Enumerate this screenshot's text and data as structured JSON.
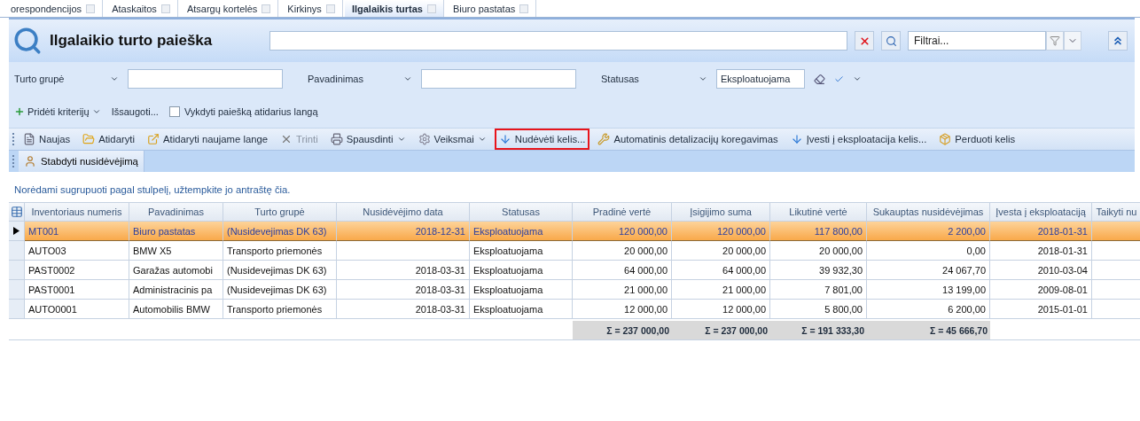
{
  "doc_tabs": [
    {
      "label": "orespondencijos",
      "selected": false
    },
    {
      "label": "Ataskaitos",
      "selected": false
    },
    {
      "label": "Atsargų kortelės",
      "selected": false
    },
    {
      "label": "Kirkinys",
      "selected": false
    },
    {
      "label": "Ilgalaikis turtas",
      "selected": true
    },
    {
      "label": "Biuro pastatas",
      "selected": false
    }
  ],
  "header": {
    "title": "Ilgalaikio turto paieška",
    "filter_placeholder": "Filtrai..."
  },
  "criteria": [
    {
      "label": "Turto grupė"
    },
    {
      "label": "Pavadinimas"
    },
    {
      "label": "Statusas",
      "value": "Eksploatuojama"
    }
  ],
  "criteria_actions": {
    "add": "Pridėti kriterijų",
    "save": "Išsaugoti...",
    "run_on_open": {
      "label": "Vykdyti paiešką atidarius langą",
      "checked": false
    }
  },
  "toolbar": [
    {
      "label": "Naujas",
      "disabled": false,
      "dropdown": false,
      "highlighted": false
    },
    {
      "label": "Atidaryti",
      "disabled": false,
      "dropdown": false,
      "highlighted": false
    },
    {
      "label": "Atidaryti naujame lange",
      "disabled": false,
      "dropdown": false,
      "highlighted": false
    },
    {
      "label": "Trinti",
      "disabled": true,
      "dropdown": false,
      "highlighted": false
    },
    {
      "label": "Spausdinti",
      "disabled": false,
      "dropdown": true,
      "highlighted": false
    },
    {
      "label": "Veiksmai",
      "disabled": false,
      "dropdown": true,
      "highlighted": false
    },
    {
      "label": "Nudėvėti kelis...",
      "disabled": false,
      "dropdown": false,
      "highlighted": true
    },
    {
      "label": "Automatinis detalizacijų koregavimas",
      "disabled": false,
      "dropdown": false,
      "highlighted": false
    },
    {
      "label": "Įvesti į eksploatacija kelis...",
      "disabled": false,
      "dropdown": false,
      "highlighted": false
    },
    {
      "label": "Perduoti kelis",
      "disabled": false,
      "dropdown": false,
      "highlighted": false
    }
  ],
  "toolbar2": [
    {
      "label": "Stabdyti nusidėvėjimą"
    }
  ],
  "group_hint": "Norėdami sugrupuoti pagal stulpelį, užtempkite jo antraštę čia.",
  "table": {
    "columns": [
      {
        "label": "Inventoriaus numeris",
        "kind": "text"
      },
      {
        "label": "Pavadinimas",
        "kind": "text"
      },
      {
        "label": "Turto grupė",
        "kind": "text"
      },
      {
        "label": "Nusidėvėjimo data",
        "kind": "number"
      },
      {
        "label": "Statusas",
        "kind": "text"
      },
      {
        "label": "Pradinė vertė",
        "kind": "number",
        "total": "Σ = 237 000,00"
      },
      {
        "label": "Įsigijimo suma",
        "kind": "number",
        "total": "Σ = 237 000,00"
      },
      {
        "label": "Likutinė vertė",
        "kind": "number",
        "total": "Σ = 191 333,30"
      },
      {
        "label": "Sukauptas nusidėvėjimas",
        "kind": "number",
        "total": "Σ = 45 666,70"
      },
      {
        "label": "Įvesta į eksploataciją",
        "kind": "number"
      },
      {
        "label": "Taikyti nu",
        "kind": "text"
      }
    ],
    "rows": [
      {
        "selected": true,
        "cells": [
          "MT001",
          "Biuro pastatas",
          "(Nusidevejimas DK 63)",
          "2018-12-31",
          "Eksploatuojama",
          "120 000,00",
          "120 000,00",
          "117 800,00",
          "2 200,00",
          "2018-01-31"
        ]
      },
      {
        "selected": false,
        "cells": [
          "AUTO03",
          "BMW X5",
          "Transporto priemonės",
          "",
          "Eksploatuojama",
          "20 000,00",
          "20 000,00",
          "20 000,00",
          "0,00",
          "2018-01-31"
        ]
      },
      {
        "selected": false,
        "cells": [
          "PAST0002",
          "Garažas automobi",
          "(Nusidevejimas DK 63)",
          "2018-03-31",
          "Eksploatuojama",
          "64 000,00",
          "64 000,00",
          "39 932,30",
          "24 067,70",
          "2010-03-04"
        ]
      },
      {
        "selected": false,
        "cells": [
          "PAST0001",
          "Administracinis pa",
          "(Nusidevejimas DK 63)",
          "2018-03-31",
          "Eksploatuojama",
          "21 000,00",
          "21 000,00",
          "7 801,00",
          "13 199,00",
          "2009-08-01"
        ]
      },
      {
        "selected": false,
        "cells": [
          "AUTO0001",
          "Automobilis BMW",
          "Transporto priemonės",
          "2018-03-31",
          "Eksploatuojama",
          "12 000,00",
          "12 000,00",
          "5 800,00",
          "6 200,00",
          "2015-01-01"
        ]
      }
    ]
  }
}
